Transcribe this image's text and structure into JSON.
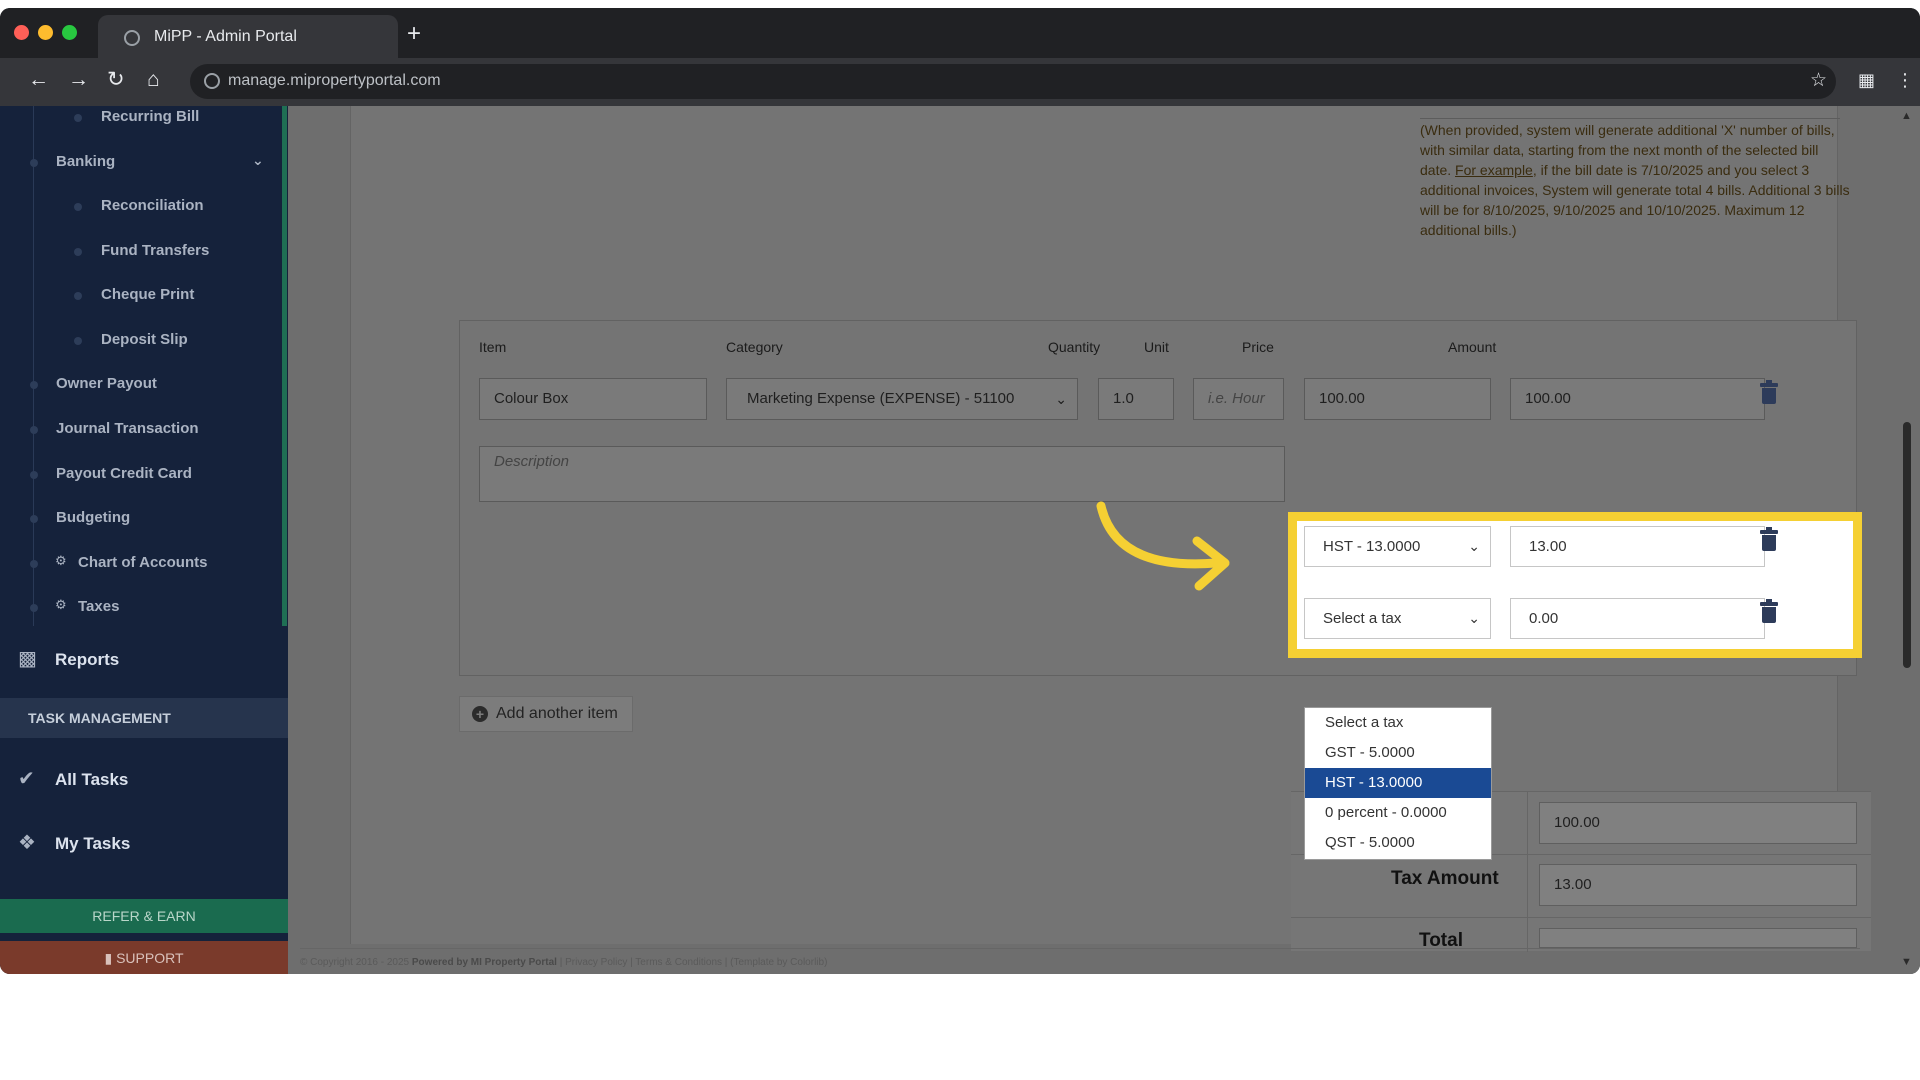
{
  "browser": {
    "tab_title": "MiPP - Admin Portal",
    "new_tab": "+",
    "url": "manage.mipropertyportal.com",
    "icons": [
      "back-icon",
      "forward-icon",
      "reload-icon",
      "home-icon",
      "bookmark-star-icon",
      "extensions-icon",
      "menu-icon"
    ]
  },
  "sidebar": {
    "items": [
      {
        "label": "Recurring Bill"
      },
      {
        "label": "Banking"
      },
      {
        "label": "Reconciliation"
      },
      {
        "label": "Fund Transfers"
      },
      {
        "label": "Cheque Print"
      },
      {
        "label": "Deposit Slip"
      },
      {
        "label": "Owner Payout"
      },
      {
        "label": "Journal Transaction"
      },
      {
        "label": "Payout Credit Card"
      },
      {
        "label": "Budgeting"
      },
      {
        "label": "Chart of Accounts"
      },
      {
        "label": "Taxes"
      }
    ],
    "reports": "Reports",
    "task_header": "TASK MANAGEMENT",
    "all_tasks": "All Tasks",
    "my_tasks": "My Tasks",
    "refer": "REFER & EARN",
    "support": "SUPPORT"
  },
  "note": {
    "part1": "(When provided, system will generate additional 'X' number of bills, with similar data, starting from the next month of the selected bill date. ",
    "link": "For example",
    "part2": ", if the bill date is 7/10/2025 and you select 3 additional invoices, System will generate total 4 bills. Additional 3 bills will be for 8/10/2025, 9/10/2025 and 10/10/2025. Maximum 12 additional bills.)"
  },
  "items": {
    "headers": {
      "item": "Item",
      "category": "Category",
      "quantity": "Quantity",
      "unit": "Unit",
      "price": "Price",
      "amount": "Amount"
    },
    "row": {
      "item": "Colour Box",
      "category": "Marketing Expense (EXPENSE) - 51100",
      "quantity": "1.0",
      "unit_placeholder": "i.e. Hour",
      "price": "100.00",
      "amount": "100.00",
      "description_placeholder": "Description"
    },
    "taxes": [
      {
        "tax": "HST - 13.0000",
        "amount": "13.00"
      },
      {
        "tax": "Select a tax",
        "amount": "0.00"
      }
    ]
  },
  "add_item": "Add another item",
  "tax_dropdown": {
    "options": [
      "Select a tax",
      "GST - 5.0000",
      "HST - 13.0000",
      "0 percent - 0.0000",
      "QST - 5.0000"
    ],
    "selected": "HST - 13.0000"
  },
  "totals": {
    "subtotal_value": "100.00",
    "tax_label": "Tax Amount",
    "tax_value": "13.00",
    "total_label": "Total"
  },
  "footer": {
    "copyright": "© Copyright 2016 - 2025 ",
    "powered": "Powered by MI Property Portal",
    "links": " | Privacy Policy | Terms & Conditions | ",
    "template": "(Template by Colorlib)"
  },
  "colors": {
    "highlight": "#f5d033",
    "selected_option": "#1a4a94",
    "sidebar": "#15223b"
  }
}
